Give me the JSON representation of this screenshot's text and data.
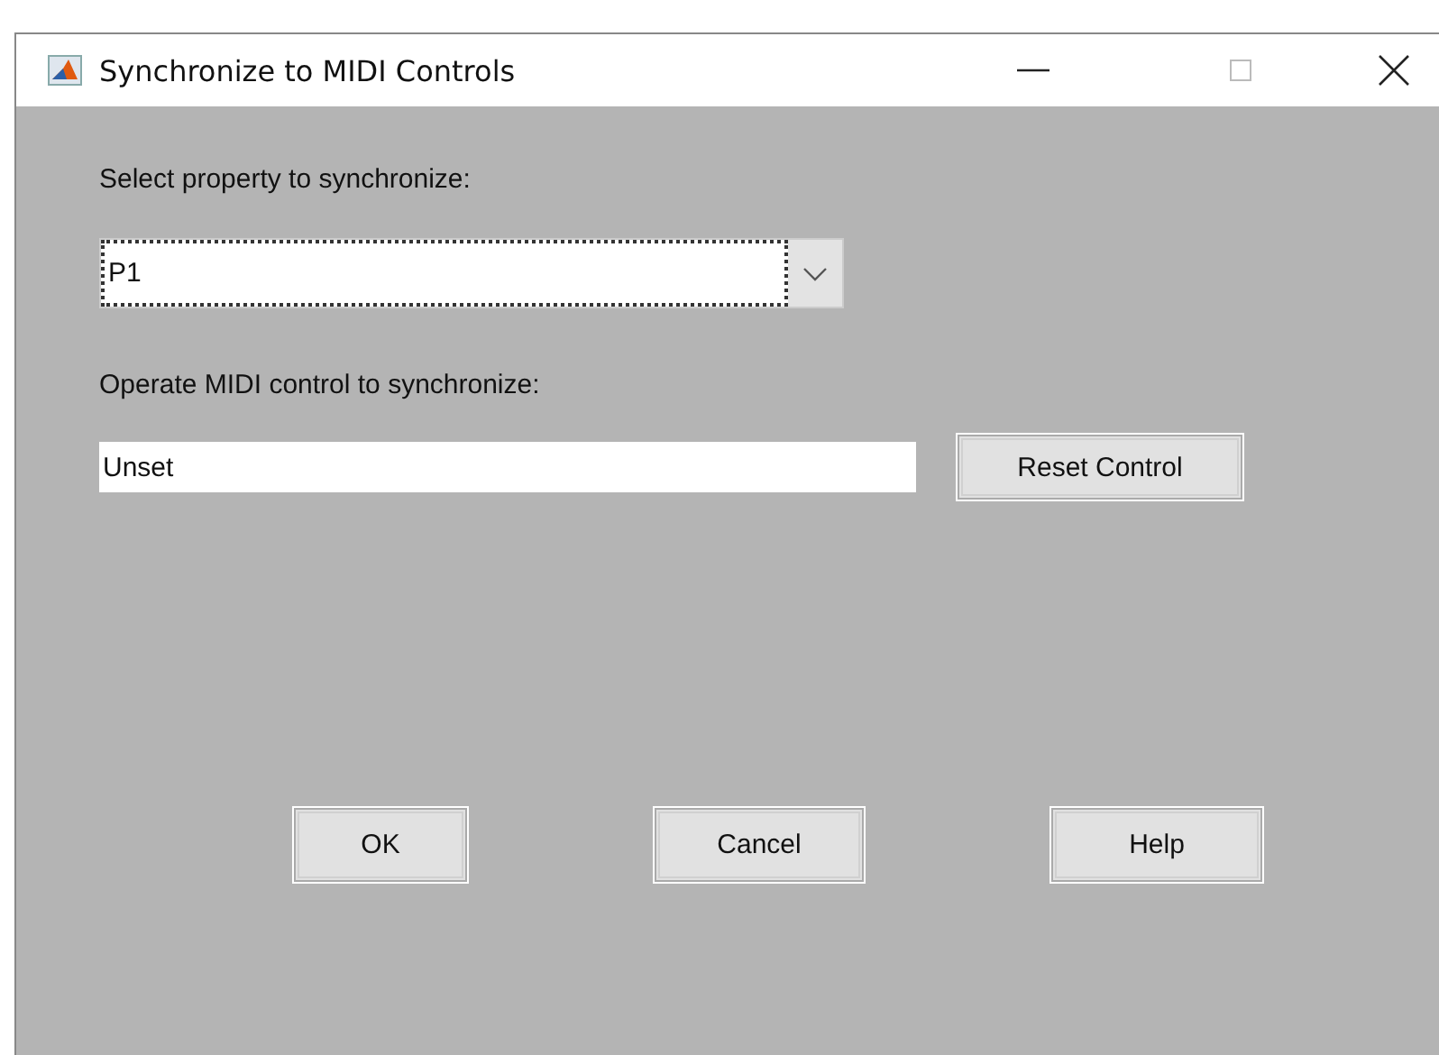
{
  "window": {
    "title": "Synchronize to MIDI Controls"
  },
  "property_label": "Select property to synchronize:",
  "property_dropdown": {
    "value": "P1",
    "focused": true
  },
  "control_label": "Operate MIDI control to synchronize:",
  "control_field": {
    "value": "Unset"
  },
  "reset_button": "Reset Control",
  "buttons": [
    "OK",
    "Cancel",
    "Help"
  ]
}
